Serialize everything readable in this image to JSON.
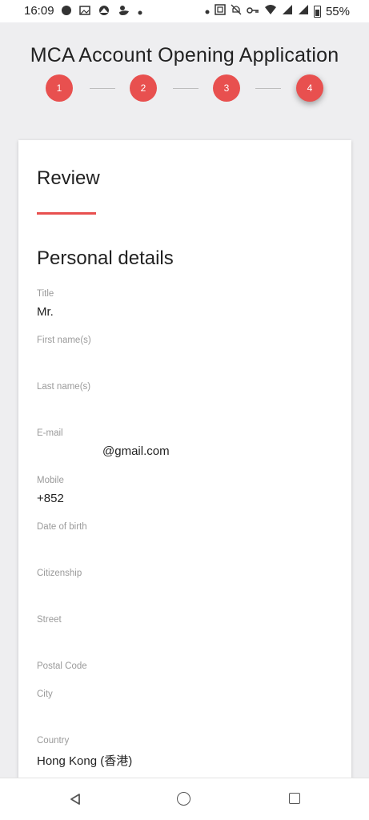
{
  "status_bar": {
    "time": "16:09",
    "battery_pct": "55%",
    "left_icons": [
      "chat-bubble-icon",
      "image-icon",
      "cloud-icon",
      "duck-icon",
      "dot-icon"
    ],
    "right_icons": [
      "dot-icon",
      "nfc-icon",
      "bell-off-icon",
      "key-icon",
      "wifi-icon",
      "volte-icon",
      "signal-icon",
      "battery-icon"
    ]
  },
  "header": {
    "title": "MCA Account Opening Application",
    "steps": [
      "1",
      "2",
      "3",
      "4"
    ],
    "active_step": 4
  },
  "card": {
    "title": "Review",
    "section_title": "Personal details",
    "accent_color": "#e8504f",
    "fields": {
      "title": {
        "label": "Title",
        "value": "Mr."
      },
      "first_name": {
        "label": "First name(s)",
        "value": ""
      },
      "last_name": {
        "label": "Last name(s)",
        "value": ""
      },
      "email": {
        "label": "E-mail",
        "value": "@gmail.com"
      },
      "mobile": {
        "label": "Mobile",
        "value": "+852"
      },
      "dob": {
        "label": "Date of birth",
        "value": ""
      },
      "citizenship": {
        "label": "Citizenship",
        "value": ""
      },
      "street": {
        "label": "Street",
        "value": ""
      },
      "postal_code": {
        "label": "Postal Code",
        "value": ""
      },
      "city": {
        "label": "City",
        "value": ""
      },
      "country": {
        "label": "Country",
        "value": "Hong Kong (香港)"
      }
    }
  },
  "nav_bar": {
    "buttons": [
      "back-icon",
      "home-icon",
      "recent-apps-icon"
    ]
  }
}
